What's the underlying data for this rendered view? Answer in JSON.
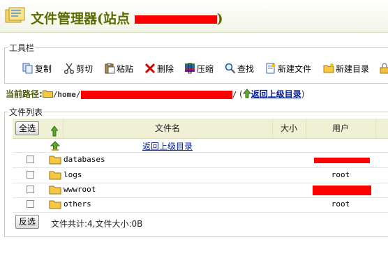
{
  "title": {
    "text": "文件管理器(站点 ",
    "suffix": ")"
  },
  "toolbar": {
    "legend": "工具栏",
    "buttons": [
      {
        "label": "复制",
        "icon": "copy-icon"
      },
      {
        "label": "剪切",
        "icon": "scissors-icon"
      },
      {
        "label": "粘贴",
        "icon": "paste-icon"
      },
      {
        "label": "删除",
        "icon": "delete-icon"
      },
      {
        "label": "压缩",
        "icon": "archive-icon"
      },
      {
        "label": "查找",
        "icon": "search-icon"
      },
      {
        "label": "新建文件",
        "icon": "new-file-icon"
      },
      {
        "label": "新建目录",
        "icon": "new-folder-icon"
      }
    ]
  },
  "path": {
    "label": "当前路径:",
    "prefix": "/home/",
    "suffix": "/",
    "open_paren": "(",
    "up_link": "返回上级目录",
    "close_paren": ")"
  },
  "filelist": {
    "legend": "文件列表",
    "select_all": "全选",
    "invert_select": "反选",
    "columns": {
      "name": "文件名",
      "size": "大小",
      "user": "用户"
    },
    "parent_link": "返回上级目录",
    "rows": [
      {
        "name": "databases",
        "user": ""
      },
      {
        "name": "logs",
        "user": "root"
      },
      {
        "name": "wwwroot",
        "user": ""
      },
      {
        "name": "others",
        "user": "root"
      }
    ],
    "summary": "文件共计:4,文件大小:0B"
  },
  "colors": {
    "accent": "#5a6b00",
    "header_bg": "#eff0d4",
    "link": "#001c9b",
    "redaction": "#ff0000"
  }
}
